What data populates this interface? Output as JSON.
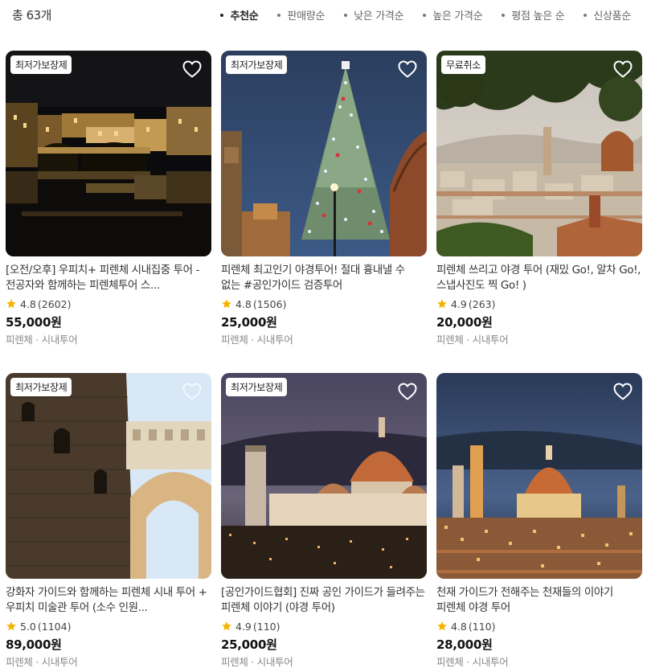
{
  "header": {
    "total": "총 63개",
    "sorts": [
      "추천순",
      "판매량순",
      "낮은 가격순",
      "높은 가격순",
      "평점 높은 순",
      "신상품순"
    ],
    "active_sort": "추천순"
  },
  "products": [
    {
      "badge": "최저가보장제",
      "title": "[오전/오후] 우피치+ 피렌체 시내집중 투어 -전공자와 함께하는 피렌체투어 스...",
      "rating": "4.8",
      "reviews": "(2602)",
      "price": "55,000원",
      "location": "피렌체 · 시내투어",
      "image_icon": "ponte-vecchio-night"
    },
    {
      "badge": "최저가보장제",
      "title": "피렌체 최고인기 야경투어! 절대 흉내낼 수 없는 #공인가이드 검증투어",
      "rating": "4.8",
      "reviews": "(1506)",
      "price": "25,000원",
      "location": "피렌체 · 시내투어",
      "image_icon": "christmas-tree-duomo"
    },
    {
      "badge": "무료취소",
      "title": "피렌체 쓰리고 야경 투어 (재밌 Go!, 알차 Go!, 스냅사진도 찍 Go! )",
      "rating": "4.9",
      "reviews": "(263)",
      "price": "20,000원",
      "location": "피렌체 · 시내투어",
      "image_icon": "florence-panorama"
    },
    {
      "badge": "최저가보장제",
      "title": "강화자 가이드와 함께하는 피렌체 시내 투어 + 우피치 미술관 투어 (소수 인원...",
      "rating": "5.0",
      "reviews": "(1104)",
      "price": "89,000원",
      "location": "피렌체 · 시내투어",
      "image_icon": "vasari-corridor"
    },
    {
      "badge": "최저가보장제",
      "title": "[공인가이드협회] 진짜 공인 가이드가 들려주는 피렌체 이야기 (야경 투어)",
      "rating": "4.9",
      "reviews": "(110)",
      "price": "25,000원",
      "location": "피렌체 · 시내투어",
      "image_icon": "duomo-dusk"
    },
    {
      "badge": "",
      "title": "천재 가이드가 전해주는 천재들의 이야기 피렌체 야경 투어",
      "rating": "4.8",
      "reviews": "(110)",
      "price": "28,000원",
      "location": "피렌체 · 시내투어",
      "image_icon": "duomo-night-city"
    }
  ],
  "colors": {
    "star": "#f5b400",
    "heart_stroke": "#ffffff",
    "active_sort": "#222222"
  }
}
